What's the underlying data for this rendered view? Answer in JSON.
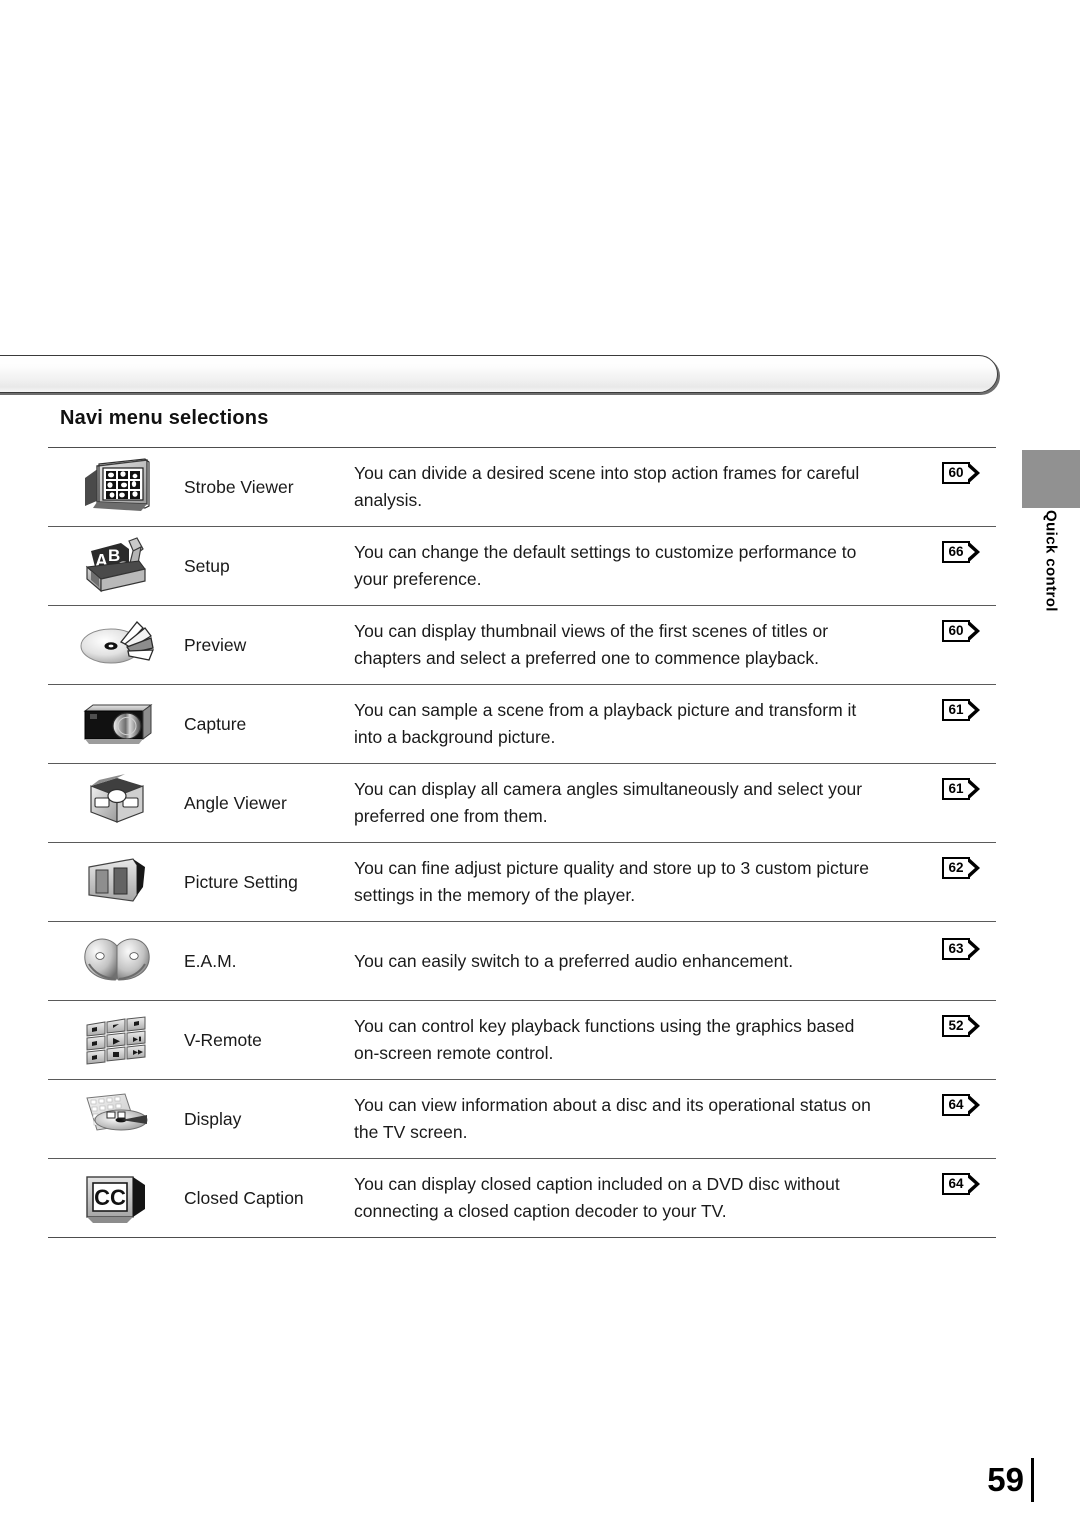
{
  "page": {
    "number": "59",
    "side_tab_label": "Quick control",
    "heading": "Navi menu selections"
  },
  "table": {
    "rows": [
      {
        "icon": "strobe-viewer-icon",
        "label": "Strobe Viewer",
        "desc_line1": "You can divide a desired scene into stop action frames for careful",
        "desc_line2": "analysis.",
        "page_ref": "60"
      },
      {
        "icon": "setup-toolbox-icon",
        "label": "Setup",
        "desc_line1": "You can change the default settings to customize performance to",
        "desc_line2": "your preference.",
        "page_ref": "66"
      },
      {
        "icon": "preview-disc-icon",
        "label": "Preview",
        "desc_line1": "You can display thumbnail views of the first scenes of titles or",
        "desc_line2": "chapters and select a preferred one to commence playback.",
        "page_ref": "60"
      },
      {
        "icon": "capture-camera-icon",
        "label": "Capture",
        "desc_line1": "You can sample a scene from a playback picture and transform it",
        "desc_line2": "into a background picture.",
        "page_ref": "61"
      },
      {
        "icon": "angle-viewer-cube-icon",
        "label": "Angle Viewer",
        "desc_line1": "You can display all camera angles simultaneously and select your",
        "desc_line2": "preferred one from them.",
        "page_ref": "61"
      },
      {
        "icon": "picture-setting-icon",
        "label": "Picture Setting",
        "desc_line1": "You can fine adjust picture quality and store up to 3 custom picture",
        "desc_line2": "settings in the memory of the player.",
        "page_ref": "62"
      },
      {
        "icon": "eam-audio-icon",
        "label": "E.A.M.",
        "desc_line1": "You can easily switch to a preferred audio enhancement.",
        "desc_line2": "",
        "page_ref": "63"
      },
      {
        "icon": "v-remote-keypad-icon",
        "label": "V-Remote",
        "desc_line1": "You can control key playback functions using the graphics based",
        "desc_line2": "on-screen remote control.",
        "page_ref": "52"
      },
      {
        "icon": "display-info-disc-icon",
        "label": "Display",
        "desc_line1": "You can view information about a disc and its operational status on",
        "desc_line2": "the TV screen.",
        "page_ref": "64"
      },
      {
        "icon": "closed-caption-tv-icon",
        "label": "Closed Caption",
        "desc_line1": "You can display closed caption included on a DVD disc without",
        "desc_line2": "connecting a closed caption decoder to your TV.",
        "page_ref": "64"
      }
    ]
  },
  "colors": {
    "side_tab_gray": "#919191",
    "rule": "#4d4d4d",
    "text": "#1a1a1a"
  }
}
